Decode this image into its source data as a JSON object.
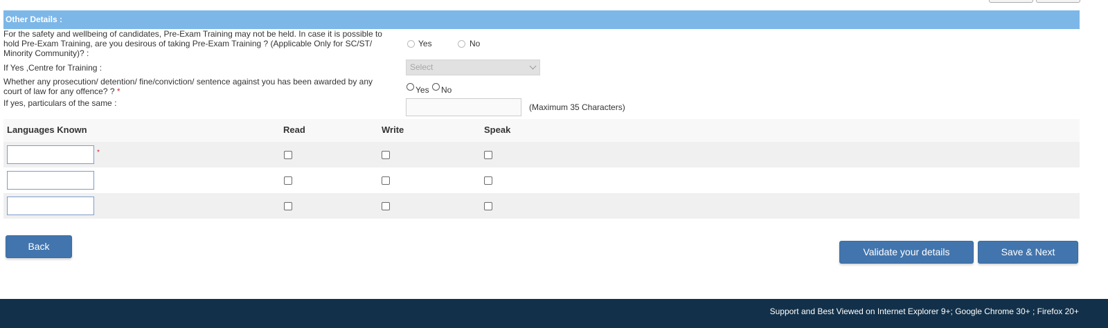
{
  "section": {
    "title": "Other Details :"
  },
  "questions": {
    "pre_exam": {
      "line1": "For the safety and wellbeing of candidates, Pre-Exam Training may not be held. In case it is possible to",
      "line2": "hold Pre-Exam Training, are you desirous of taking Pre-Exam Training ? (Applicable Only for SC/ST/",
      "line3": "Minority Community)? :",
      "yes_label": "Yes",
      "no_label": "No"
    },
    "centre": {
      "label": "If Yes ,Centre for Training :",
      "select_value": "Select"
    },
    "prosecution": {
      "line1": "Whether any prosecution/ detention/ fine/conviction/ sentence against you has been awarded by any",
      "line2": "court of law for any offence? ?",
      "required_mark": "*",
      "yes_label": "Yes",
      "no_label": "No"
    },
    "particulars": {
      "label": "If yes, particulars of the same :",
      "value": "",
      "hint": "(Maximum 35 Characters)"
    }
  },
  "languages": {
    "headers": {
      "language": "Languages Known",
      "read": "Read",
      "write": "Write",
      "speak": "Speak"
    },
    "required_mark": "*",
    "rows": [
      {
        "language": "",
        "read": false,
        "write": false,
        "speak": false
      },
      {
        "language": "",
        "read": false,
        "write": false,
        "speak": false
      },
      {
        "language": "",
        "read": false,
        "write": false,
        "speak": false
      }
    ]
  },
  "buttons": {
    "back": "Back",
    "validate": "Validate your details",
    "save_next": "Save & Next"
  },
  "footer": {
    "text": "Support and Best Viewed on Internet Explorer 9+; Google Chrome 30+ ; Firefox 20+"
  },
  "colors": {
    "section_header": "#7db7e8",
    "button": "#4275ad",
    "footer": "#123049",
    "required": "#d9232d"
  }
}
